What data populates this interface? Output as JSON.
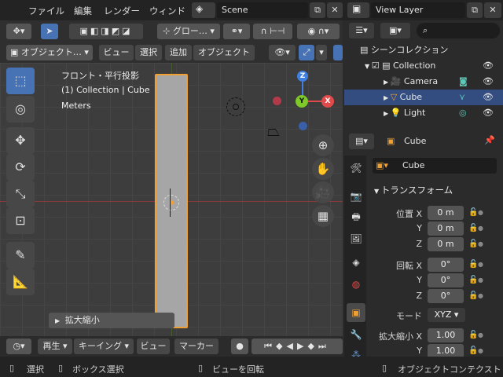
{
  "menu": {
    "file": "ファイル",
    "edit": "編集",
    "render": "レンダー",
    "window": "ウィンド"
  },
  "scene": {
    "value": "Scene"
  },
  "view_layer": {
    "value": "View Layer"
  },
  "viewport": {
    "transform_label": "グロー…",
    "mode": "オブジェクト…",
    "menus": [
      "ビュー",
      "選択",
      "追加",
      "オブジェクト"
    ],
    "overlay": {
      "line1": "フロント・平行投影",
      "line2": "(1) Collection | Cube",
      "line3": "Meters"
    },
    "operator_panel": "拡大縮小",
    "gizmo": {
      "z": "Z",
      "y": "Y",
      "x": "X"
    }
  },
  "timeline": {
    "play": "再生",
    "keying": "キーイング",
    "view": "ビュー",
    "marker": "マーカー"
  },
  "outliner": {
    "title": "シーンコレクション",
    "collection": "Collection",
    "items": [
      "Camera",
      "Cube",
      "Light"
    ]
  },
  "properties": {
    "object_name": "Cube",
    "datablock": "Cube",
    "section": "トランスフォーム",
    "location_label": "位置 X",
    "location": {
      "x": "0 m",
      "y": "0 m",
      "z": "0 m"
    },
    "rotation_label": "回転 X",
    "rotation": {
      "x": "0°",
      "y": "0°",
      "z": "0°"
    },
    "mode_label": "モード",
    "mode_value": "XYZ",
    "scale_label": "拡大縮小 X",
    "scale": {
      "x": "1.00",
      "y": "1.00"
    },
    "axis": {
      "y": "Y",
      "z": "Z"
    }
  },
  "status": {
    "select": "選択",
    "box_select": "ボックス選択",
    "rotate_view": "ビューを回転",
    "object_context": "オブジェクトコンテクスト"
  },
  "colors": {
    "accent": "#4772b3",
    "selection_orange": "#f0a030",
    "x_axis": "#e04a4a",
    "y_axis": "#7ec828",
    "z_axis": "#3f7fe0"
  }
}
